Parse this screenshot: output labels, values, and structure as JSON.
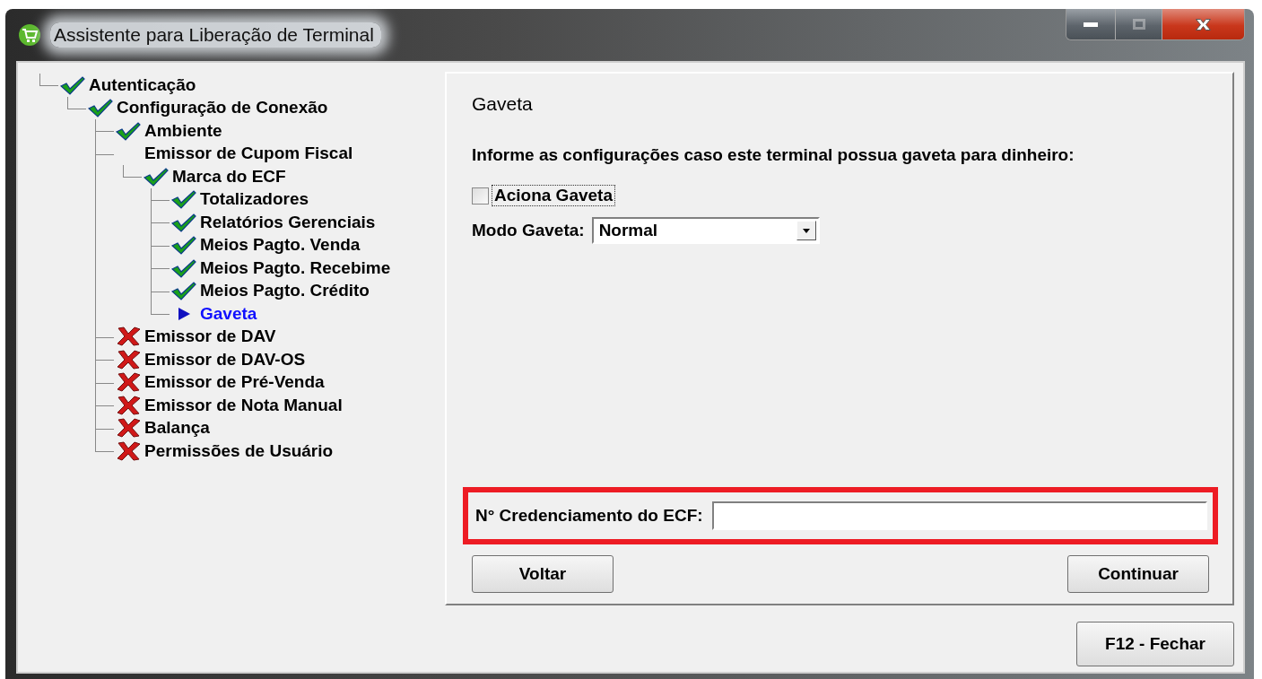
{
  "window": {
    "title": "Assistente para Liberação de Terminal",
    "controls": [
      {
        "kind": "minimize",
        "disabled": false
      },
      {
        "kind": "maximize",
        "disabled": true
      },
      {
        "kind": "close",
        "disabled": false
      }
    ]
  },
  "tree": [
    {
      "label": "Autenticação",
      "kind": "done",
      "children": [
        {
          "label": "Configuração de Conexão",
          "kind": "done",
          "children": [
            {
              "label": "Ambiente",
              "kind": "done"
            },
            {
              "label": "Emissor de Cupom Fiscal",
              "kind": "plain",
              "children": [
                {
                  "label": "Marca do ECF",
                  "kind": "done",
                  "children": [
                    {
                      "label": "Totalizadores",
                      "kind": "done"
                    },
                    {
                      "label": "Relatórios Gerenciais",
                      "kind": "done"
                    },
                    {
                      "label": "Meios Pagto. Venda",
                      "kind": "done"
                    },
                    {
                      "label": "Meios Pagto. Recebime",
                      "kind": "done"
                    },
                    {
                      "label": "Meios Pagto. Crédito",
                      "kind": "done"
                    },
                    {
                      "label": "Gaveta",
                      "kind": "current"
                    }
                  ]
                }
              ]
            },
            {
              "label": "Emissor de DAV",
              "kind": "error"
            },
            {
              "label": "Emissor de DAV-OS",
              "kind": "error"
            },
            {
              "label": "Emissor de Pré-Venda",
              "kind": "error"
            },
            {
              "label": "Emissor de Nota Manual",
              "kind": "error"
            },
            {
              "label": "Balança",
              "kind": "error"
            },
            {
              "label": "Permissões de Usuário",
              "kind": "error"
            }
          ]
        }
      ]
    }
  ],
  "panel": {
    "title": "Gaveta",
    "instruction": "Informe as configurações caso este terminal possua gaveta para dinheiro:",
    "checkbox": {
      "label": "Aciona Gaveta",
      "checked": false,
      "focused": true
    },
    "mode": {
      "label": "Modo Gaveta:",
      "value": "Normal"
    },
    "credential": {
      "label": "N° Credenciamento do ECF:",
      "highlighted": true
    },
    "buttons": [
      "Voltar",
      "Continuar"
    ]
  },
  "close_button": "F12 - Fechar"
}
